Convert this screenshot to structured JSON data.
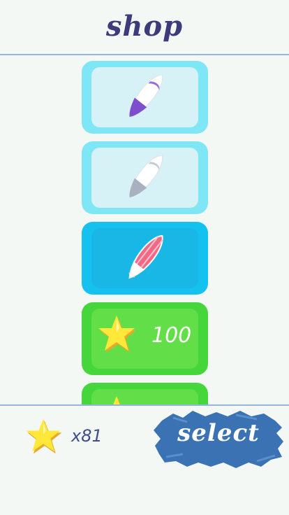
{
  "header": {
    "title": "shop"
  },
  "shop": {
    "items": [
      {
        "board_icon": "surfboard-purple-icon",
        "state": "owned"
      },
      {
        "board_icon": "surfboard-gray-icon",
        "state": "owned"
      },
      {
        "board_icon": "surfboard-pink-icon",
        "state": "selected"
      },
      {
        "state": "locked",
        "price_icon": "star-icon",
        "price": "100"
      },
      {
        "state": "locked",
        "price_icon": "star-icon"
      }
    ]
  },
  "footer": {
    "coin_icon": "star-icon",
    "coin_count": "x81",
    "select_label": "select"
  },
  "colors": {
    "title": "#3e3b7a",
    "divider": "#93b6d9",
    "owned_card": "#7fe6f6",
    "selected_card": "#14c1ef",
    "locked_card": "#45d63c",
    "select_button": "#3a72b3"
  }
}
